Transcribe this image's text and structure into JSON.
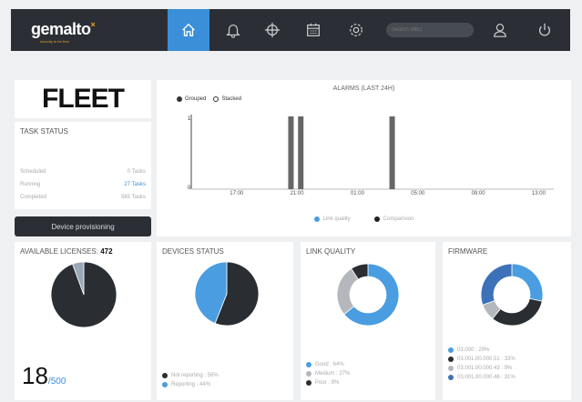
{
  "header": {
    "logo": "gemalto",
    "logo_mark": "×",
    "tagline": "security to be free",
    "search_placeholder": "Search IMEI"
  },
  "fleet_label": "FLEET",
  "task_status": {
    "title": "TASK STATUS",
    "rows": [
      {
        "label": "Scheduled",
        "value": "0 Tasks",
        "color": "#aaaaaa"
      },
      {
        "label": "Running",
        "value": "27 Tasks",
        "color": "#3a8fd8"
      },
      {
        "label": "Completed",
        "value": "565 Tasks",
        "color": "#aaaaaa"
      }
    ]
  },
  "provision_button": "Device provisioning",
  "alarms": {
    "title": "ALARMS (LAST 24H)",
    "mode_grouped": "Grouped",
    "mode_stacked": "Stacked",
    "legend_link": "Link quality",
    "legend_comp": "Comparision"
  },
  "licenses": {
    "title": "AVAILABLE LICENSES:",
    "count": "472",
    "used": "18",
    "total": "/500"
  },
  "devices_status": {
    "title": "DEVICES STATUS",
    "legend": [
      "Not reporting : 56%",
      "Reporting : 44%"
    ]
  },
  "link_quality": {
    "title": "LINK QUALITY",
    "legend": [
      "Good : 64%",
      "Medium : 27%",
      "Poor : 9%"
    ]
  },
  "firmware": {
    "title": "FIRMWARE",
    "legend": [
      "03.000 : 29%",
      "03.001.00.000.51 : 33%",
      "03.001.00.000.43 : 9%",
      "03.001.00.000.46 : 31%"
    ]
  },
  "chart_data": [
    {
      "type": "bar",
      "title": "ALARMS (LAST 24H)",
      "x_ticks": [
        "17:00",
        "21:00",
        "01:00",
        "05:00",
        "09:00",
        "13:00"
      ],
      "y_ticks": [
        "0",
        "1"
      ],
      "ylim": [
        0,
        1
      ],
      "series": [
        {
          "name": "Comparision",
          "color": "#666666",
          "points": [
            {
              "x": 20.6,
              "y": 1
            },
            {
              "x": 21.25,
              "y": 1
            },
            {
              "x": 3.3,
              "y": 1
            }
          ]
        }
      ]
    },
    {
      "type": "pie",
      "title": "AVAILABLE LICENSES",
      "values": [
        472,
        28
      ],
      "colors": [
        "#2a2e33",
        "#9aa7b6"
      ]
    },
    {
      "type": "pie",
      "title": "DEVICES STATUS",
      "values": [
        56,
        44
      ],
      "labels": [
        "Not reporting",
        "Reporting"
      ],
      "colors": [
        "#2a2e33",
        "#4a9de0"
      ]
    },
    {
      "type": "pie",
      "title": "LINK QUALITY",
      "donut": true,
      "values": [
        64,
        27,
        9
      ],
      "labels": [
        "Good",
        "Medium",
        "Poor"
      ],
      "colors": [
        "#4a9de0",
        "#b4b8bd",
        "#2a2e33"
      ]
    },
    {
      "type": "pie",
      "title": "FIRMWARE",
      "donut": true,
      "values": [
        29,
        33,
        9,
        31
      ],
      "labels": [
        "03.000",
        "03.001.00.000.51",
        "03.001.00.000.43",
        "03.001.00.000.46"
      ],
      "colors": [
        "#4a9de0",
        "#2a2e33",
        "#b4b8bd",
        "#3d72b8"
      ]
    }
  ]
}
